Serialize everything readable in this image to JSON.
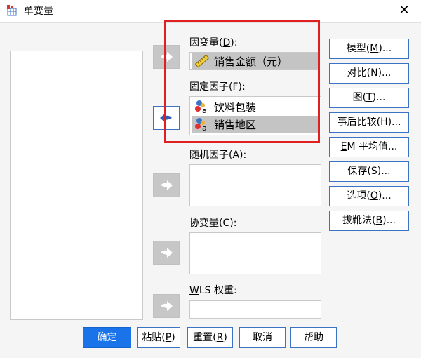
{
  "window": {
    "title": "单变量",
    "close_glyph": "✕"
  },
  "dependent": {
    "label_pre": "因变量(",
    "label_key": "D",
    "label_post": "):",
    "value": "销售金额（元）",
    "icon": "ruler-scale-icon"
  },
  "fixed_factor": {
    "label_pre": "固定因子(",
    "label_key": "F",
    "label_post": "):",
    "items": [
      {
        "label": "饮料包装",
        "icon": "nominal-variable-icon",
        "selected": false
      },
      {
        "label": "销售地区",
        "icon": "nominal-variable-icon",
        "selected": true
      }
    ]
  },
  "random_factor": {
    "label_pre": "随机因子(",
    "label_key": "A",
    "label_post": "):"
  },
  "covariate": {
    "label_pre": "协变量(",
    "label_key": "C",
    "label_post": "):"
  },
  "wls": {
    "label_key": "W",
    "label_post": "LS 权重:"
  },
  "side_buttons": [
    {
      "pre": "模型(",
      "key": "M",
      "post": ")..."
    },
    {
      "pre": "对比(",
      "key": "N",
      "post": ")..."
    },
    {
      "pre": "图(",
      "key": "T",
      "post": ")..."
    },
    {
      "pre": "事后比较(",
      "key": "H",
      "post": ")..."
    },
    {
      "pre": "",
      "key": "E",
      "post": "M 平均值..."
    },
    {
      "pre": "保存(",
      "key": "S",
      "post": ")..."
    },
    {
      "pre": "选项(",
      "key": "O",
      "post": ")..."
    },
    {
      "pre": "拔靴法(",
      "key": "B",
      "post": ")..."
    }
  ],
  "bottom_buttons": [
    {
      "label": "确定",
      "key": ""
    },
    {
      "label": "粘贴(",
      "key": "P",
      "post": ")"
    },
    {
      "label": "重置(",
      "key": "R",
      "post": ")"
    },
    {
      "label": "取消",
      "key": ""
    },
    {
      "label": "帮助",
      "key": ""
    }
  ],
  "colors": {
    "accent": "#1a73e8",
    "highlight": "#e02020",
    "button_border": "#3b73c4",
    "selection": "#c4c4c4"
  }
}
